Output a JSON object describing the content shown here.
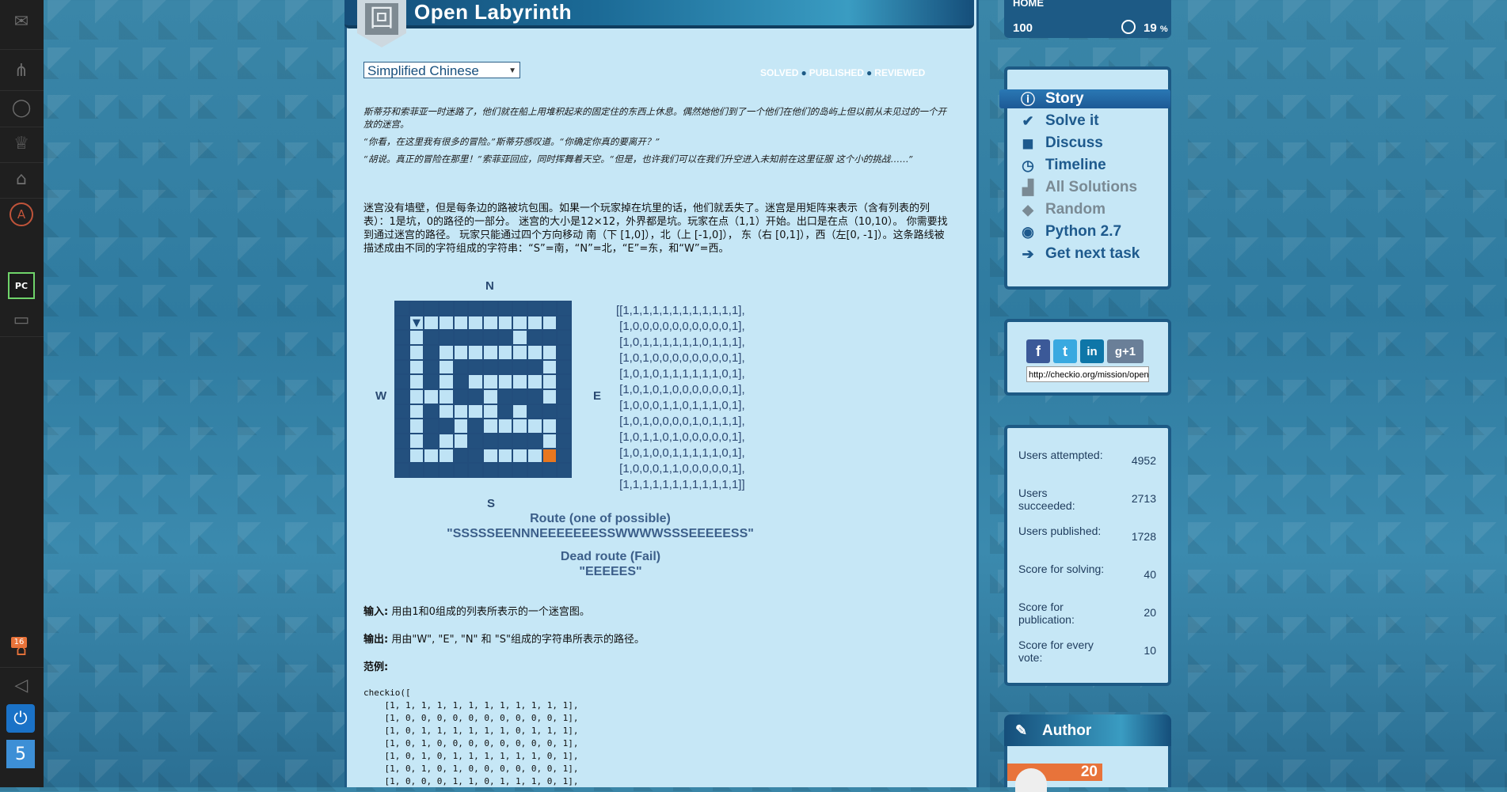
{
  "rail": {
    "icons": [
      "envelope-icon",
      "tree-icon",
      "speech-icon",
      "trophy-icon",
      "hat-icon",
      "a-circle-icon",
      "pycharm-icon",
      "briefcase-icon",
      "announcement-icon",
      "megaphone-icon",
      "power-icon",
      "five-icon"
    ],
    "notification_count": "16",
    "pc_label": "PC",
    "a_label": "A",
    "five_label": "5"
  },
  "header": {
    "title": "Open Labyrinth"
  },
  "top_stats": {
    "home_label": "HOME",
    "home_value": "100",
    "percent_value": "19",
    "percent_unit": "%"
  },
  "language": {
    "selected": "Simplified Chinese"
  },
  "status": {
    "solved": "SOLVED",
    "published": "PUBLISHED",
    "reviewed": "REVIEWED"
  },
  "story": {
    "p1": "斯蒂芬和索菲亚一时迷路了，他们就在船上用堆积起来的固定住的东西上休息。偶然她他们到了一个他们在他们的岛屿上但以前从未见过的一个开放的迷宫。",
    "p2": "“你看，在这里我有很多的冒险。”斯蒂芬感叹道。“你确定你真的要离开？”",
    "p3": "“胡说。真正的冒险在那里！”索菲亚回应，同时挥舞着天空。“但是，也许我们可以在我们升空进入未知前在这里征服 这个小的挑战……”"
  },
  "description": "迷宫没有墙壁，但是每条边的路被坑包围。如果一个玩家掉在坑里的话，他们就丢失了。迷宫是用矩阵来表示（含有列表的列表）：1是坑，0的路径的一部分。 迷宫的大小是12×12，外界都是坑。玩家在点（1,1）开始。出口是在点（10,10）。 你需要找到通过迷宫的路径。 玩家只能通过四个方向移动 南（下 [1,0]），北（上 [-1,0]），  东（右 [0,1]），西（左[0, -1]）。这条路线被描述成由不同的字符组成的字符串：“S”=南，“N”=北，“E”=东，和“W”=西。",
  "maze": {
    "north": "N",
    "south": "S",
    "west": "W",
    "east": "E",
    "grid": [
      [
        1,
        1,
        1,
        1,
        1,
        1,
        1,
        1,
        1,
        1,
        1,
        1
      ],
      [
        1,
        0,
        0,
        0,
        0,
        0,
        0,
        0,
        0,
        0,
        0,
        1
      ],
      [
        1,
        0,
        1,
        1,
        1,
        1,
        1,
        1,
        0,
        1,
        1,
        1
      ],
      [
        1,
        0,
        1,
        0,
        0,
        0,
        0,
        0,
        0,
        0,
        0,
        1
      ],
      [
        1,
        0,
        1,
        0,
        1,
        1,
        1,
        1,
        1,
        1,
        0,
        1
      ],
      [
        1,
        0,
        1,
        0,
        1,
        0,
        0,
        0,
        0,
        0,
        0,
        1
      ],
      [
        1,
        0,
        0,
        0,
        1,
        1,
        0,
        1,
        1,
        1,
        0,
        1
      ],
      [
        1,
        0,
        1,
        0,
        0,
        0,
        0,
        1,
        0,
        1,
        1,
        1
      ],
      [
        1,
        0,
        1,
        1,
        0,
        1,
        0,
        0,
        0,
        0,
        0,
        1
      ],
      [
        1,
        0,
        1,
        0,
        0,
        1,
        1,
        1,
        1,
        1,
        0,
        1
      ],
      [
        1,
        0,
        0,
        0,
        1,
        1,
        0,
        0,
        0,
        0,
        0,
        1
      ],
      [
        1,
        1,
        1,
        1,
        1,
        1,
        1,
        1,
        1,
        1,
        1,
        1
      ]
    ],
    "matrix_lines": [
      "[[1,1,1,1,1,1,1,1,1,1,1,1],",
      " [1,0,0,0,0,0,0,0,0,0,0,1],",
      " [1,0,1,1,1,1,1,1,0,1,1,1],",
      " [1,0,1,0,0,0,0,0,0,0,0,1],",
      " [1,0,1,0,1,1,1,1,1,1,0,1],",
      " [1,0,1,0,1,0,0,0,0,0,0,1],",
      " [1,0,0,0,1,1,0,1,1,1,0,1],",
      " [1,0,1,0,0,0,0,1,0,1,1,1],",
      " [1,0,1,1,0,1,0,0,0,0,0,1],",
      " [1,0,1,0,0,1,1,1,1,1,0,1],",
      " [1,0,0,0,1,1,0,0,0,0,0,1],",
      " [1,1,1,1,1,1,1,1,1,1,1,1]]"
    ],
    "colors": {
      "wall": "#23507e",
      "path": "#bfe3f5",
      "exit": "#e8771f",
      "start": "#1f4b7a"
    }
  },
  "routes": {
    "ok_title": "Route (one of possible)",
    "ok_value": "\"SSSSSEENNNEEEEEEESSWWWWSSSEEEEESS\"",
    "fail_title": "Dead route (Fail)",
    "fail_value": "\"EEEEES\""
  },
  "io": {
    "input_label": "输入:",
    "input_text": " 用由1和0组成的列表所表示的一个迷宫图。",
    "output_label": "输出:",
    "output_text": " 用由\"W\", \"E\", \"N\" 和 \"S\"组成的字符串所表示的路径。",
    "example_label": "范例:"
  },
  "code": "checkio([\n    [1, 1, 1, 1, 1, 1, 1, 1, 1, 1, 1, 1],\n    [1, 0, 0, 0, 0, 0, 0, 0, 0, 0, 0, 1],\n    [1, 0, 1, 1, 1, 1, 1, 1, 0, 1, 1, 1],\n    [1, 0, 1, 0, 0, 0, 0, 0, 0, 0, 0, 1],\n    [1, 0, 1, 0, 1, 1, 1, 1, 1, 1, 0, 1],\n    [1, 0, 1, 0, 1, 0, 0, 0, 0, 0, 0, 1],\n    [1, 0, 0, 0, 1, 1, 0, 1, 1, 1, 0, 1],",
  "nav": {
    "items": [
      {
        "label": "Story",
        "icon": "info-icon"
      },
      {
        "label": "Solve it",
        "icon": "checkmark-icon"
      },
      {
        "label": "Discuss",
        "icon": "chat-bubbles-icon"
      },
      {
        "label": "Timeline",
        "icon": "clock-icon"
      },
      {
        "label": "All Solutions",
        "icon": "podium-icon"
      },
      {
        "label": "Random",
        "icon": "dice-icon"
      },
      {
        "label": "Python 2.7",
        "icon": "python-icon"
      },
      {
        "label": "Get next task",
        "icon": "double-arrow-icon"
      }
    ]
  },
  "share": {
    "facebook": "f",
    "twitter": "t",
    "linkedin": "in",
    "gplus": "g+1",
    "url": "http://checkio.org/mission/open-labyrinth"
  },
  "stats": [
    {
      "label": "Users attempted:",
      "value": "4952"
    },
    {
      "label": "Users succeeded:",
      "value": "2713"
    },
    {
      "label": "Users published:",
      "value": "1728"
    },
    {
      "label": "Score for solving:",
      "value": "40"
    },
    {
      "label": "Score for publication:",
      "value": "20"
    },
    {
      "label": "Score for every vote:",
      "value": "10"
    }
  ],
  "author": {
    "title": "Author",
    "score": "20"
  }
}
